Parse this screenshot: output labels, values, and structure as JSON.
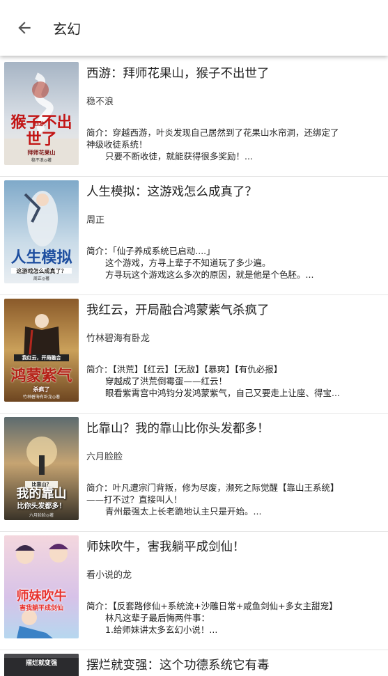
{
  "header": {
    "title": "玄幻"
  },
  "books": [
    {
      "title": "西游：拜师花果山，猴子不出世了",
      "author": "稳不浪",
      "intro_label": "简介：",
      "intro_lines": [
        "穿越西游，叶炎发现自己居然到了花果山水帘洞，还绑定了",
        "神级收徒系统！",
        "只要不断收徒，就能获得很多奖励！..."
      ],
      "cover": {
        "top": "西游：",
        "big": "猴子不出世了",
        "small": "拜师花果山",
        "author": "稳不浪◎著"
      }
    },
    {
      "title": "人生模拟：这游戏怎么成真了？",
      "author": "周正",
      "intro_label": "简介：",
      "intro_lines": [
        "「仙子养成系统已启动....」",
        "这个游戏，方寻上辈子不知道玩了多少遍。",
        "方寻玩这个游戏这么多次的原因，就是他是个色胚。..."
      ],
      "cover": {
        "top": "",
        "big": "人生模拟",
        "small": "这游戏怎么成真了？",
        "author": "周正◎著"
      }
    },
    {
      "title": "我红云，开局融合鸿蒙紫气杀疯了",
      "author": "竹林碧海有卧龙",
      "intro_label": "简介：",
      "intro_lines": [
        "【洪荒】【红云】【无敌】【暴爽】【有仇必报】",
        "穿越成了洪荒倒霉蛋——红云！",
        "眼看紫霄宫中鸿钧分发鸿蒙紫气，自己又要走上让座、得宝..."
      ],
      "cover": {
        "top": "我红云，开局融合",
        "big": "鸿蒙紫气",
        "small": "杀疯了",
        "author": "竹林碧海有卧龙◎著"
      }
    },
    {
      "title": "比靠山？我的靠山比你头发都多！",
      "author": "六月脸脸",
      "intro_label": "简介：",
      "intro_lines": [
        "叶凡遭宗门背叛，修为尽废，濒死之际觉醒【靠山王系统】",
        "——打不过？直接叫人！",
        "青州最强太上长老跪地认主只是开始。..."
      ],
      "cover": {
        "top": "比靠山？",
        "big": "我的靠山",
        "small": "比你头发都多！",
        "author": "六月脸脸◎著"
      }
    },
    {
      "title": "师妹吹牛，害我躺平成剑仙！",
      "author": "看小说的龙",
      "intro_label": "简介：",
      "intro_lines": [
        "【反套路修仙+系统流+沙雕日常+咸鱼剑仙+多女主甜宠】",
        "林凡这辈子最后悔两件事：",
        "1.给师妹讲太多玄幻小说！..."
      ],
      "cover": {
        "top": "",
        "big": "师妹吹牛",
        "small": "害我躺平成剑仙",
        "author": ""
      }
    },
    {
      "title": "摆烂就变强：这个功德系统它有毒",
      "author": "",
      "intro_label": "",
      "intro_lines": [],
      "cover": {
        "top": "摆烂就变强",
        "big": "",
        "small": "",
        "author": ""
      }
    }
  ],
  "colors": {
    "appbar_bg": "#ffffff",
    "divider": "#e6e6e6",
    "text": "#222222"
  }
}
